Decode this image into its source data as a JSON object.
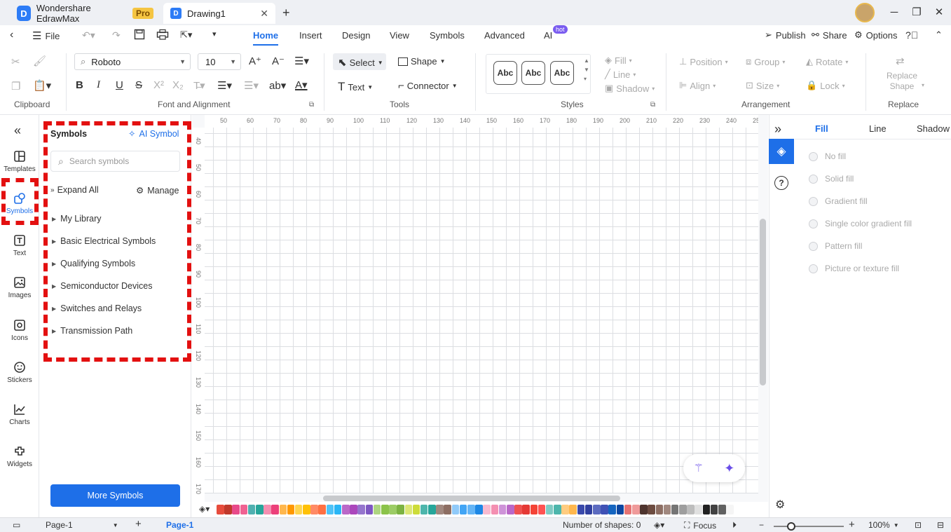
{
  "titlebar": {
    "app_name": "Wondershare EdrawMax",
    "pro_badge": "Pro",
    "doc_tab": "Drawing1",
    "new_tab": "+"
  },
  "menu": {
    "file": "File",
    "tabs": [
      "Home",
      "Insert",
      "Design",
      "View",
      "Symbols",
      "Advanced",
      "AI"
    ],
    "active_tab": "Home",
    "ai_badge": "hot",
    "publish": "Publish",
    "share": "Share",
    "options": "Options"
  },
  "ribbon": {
    "groups": {
      "clipboard": "Clipboard",
      "font": "Font and Alignment",
      "tools": "Tools",
      "styles": "Styles",
      "arrangement": "Arrangement",
      "replace": "Replace"
    },
    "font_name": "Roboto",
    "font_size": "10",
    "select": "Select",
    "shape": "Shape",
    "text": "Text",
    "connector": "Connector",
    "style_sample": "Abc",
    "fill": "Fill",
    "line": "Line",
    "shadow": "Shadow",
    "position": "Position",
    "group": "Group",
    "rotate": "Rotate",
    "align": "Align",
    "size": "Size",
    "lock": "Lock",
    "replace_shape_line1": "Replace",
    "replace_shape_line2": "Shape",
    "ab_label": "ab"
  },
  "leftrail": {
    "items": [
      {
        "label": "Templates",
        "icon": "templates-icon"
      },
      {
        "label": "Symbols",
        "icon": "symbols-icon"
      },
      {
        "label": "Text",
        "icon": "text-icon"
      },
      {
        "label": "Images",
        "icon": "images-icon"
      },
      {
        "label": "Icons",
        "icon": "icons-icon"
      },
      {
        "label": "Stickers",
        "icon": "stickers-icon"
      },
      {
        "label": "Charts",
        "icon": "charts-icon"
      },
      {
        "label": "Widgets",
        "icon": "widgets-icon"
      }
    ],
    "active": "Symbols"
  },
  "symbols_panel": {
    "title": "Symbols",
    "ai_symbol": "AI Symbol",
    "search_placeholder": "Search symbols",
    "expand_all": "Expand All",
    "manage": "Manage",
    "libraries": [
      "My Library",
      "Basic Electrical Symbols",
      "Qualifying Symbols",
      "Semiconductor Devices",
      "Switches and Relays",
      "Transmission Path"
    ],
    "more_button": "More Symbols"
  },
  "canvas": {
    "ruler_top": [
      "50",
      "60",
      "70",
      "80",
      "90",
      "100",
      "110",
      "120",
      "130",
      "140",
      "150",
      "160",
      "170",
      "180",
      "190",
      "200",
      "210",
      "220",
      "230",
      "240",
      "25"
    ],
    "ruler_left": [
      "40",
      "50",
      "60",
      "70",
      "80",
      "90",
      "100",
      "110",
      "120",
      "130",
      "140",
      "150",
      "160",
      "170"
    ]
  },
  "colors": {
    "accent": "#1e6fe8",
    "highlight": "#e31010",
    "palette": [
      "#e74c3c",
      "#c0392b",
      "#e84a8a",
      "#f06292",
      "#4fb0b0",
      "#26a69a",
      "#f48fb1",
      "#ec407a",
      "#ffb74d",
      "#ff9800",
      "#ffd54f",
      "#ffc107",
      "#ff8a65",
      "#ff7043",
      "#4fc3f7",
      "#29b6f6",
      "#ba68c8",
      "#ab47bc",
      "#9575cd",
      "#7e57c2",
      "#aed581",
      "#8bc34a",
      "#9ccc65",
      "#7cb342",
      "#dce775",
      "#cddc39",
      "#4db6ac",
      "#26a69a",
      "#a1887f",
      "#8d6e63",
      "#90caf9",
      "#42a5f5",
      "#64b5f6",
      "#1e88e5",
      "#f8bbd0",
      "#f48fb1",
      "#ce93d8",
      "#ba68c8",
      "#ef5350",
      "#e53935",
      "#f44336",
      "#ff5252",
      "#80cbc4",
      "#4db6ac",
      "#ffcc80",
      "#ffb74d",
      "#3949ab",
      "#303f9f",
      "#5c6bc0",
      "#3f51b5",
      "#1565c0",
      "#0d47a1",
      "#e57373",
      "#ef9a9a",
      "#4e342e",
      "#6d4c41",
      "#8d6e63",
      "#a1887f",
      "#757575",
      "#9e9e9e",
      "#bdbdbd",
      "#e0e0e0",
      "#212121",
      "#424242",
      "#616161",
      "#f5f5f5"
    ]
  },
  "right_panel": {
    "tabs": [
      "Fill",
      "Line",
      "Shadow"
    ],
    "active_tab": "Fill",
    "options": [
      "No fill",
      "Solid fill",
      "Gradient fill",
      "Single color gradient fill",
      "Pattern fill",
      "Picture or texture fill"
    ]
  },
  "statusbar": {
    "page_select": "Page-1",
    "page_tab": "Page-1",
    "shape_count": "Number of shapes: 0",
    "focus": "Focus",
    "zoom": "100%"
  }
}
